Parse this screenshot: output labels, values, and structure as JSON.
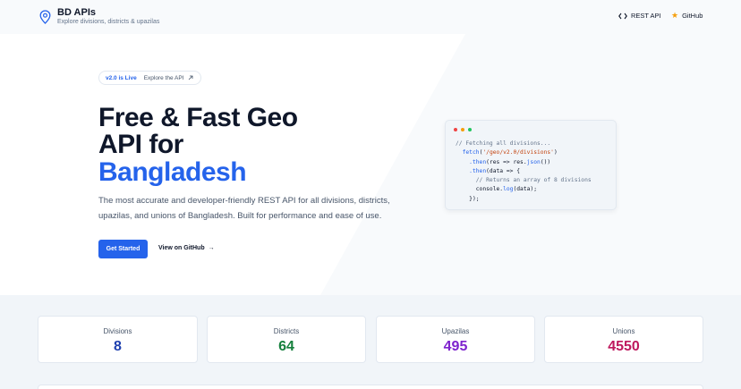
{
  "header": {
    "title": "BD APIs",
    "subtitle": "Explore divisions, districts & upazilas",
    "nav": {
      "rest_api": "REST API",
      "github": "GitHub"
    }
  },
  "hero": {
    "badge": "v2.0 is Live",
    "badge_link": "Explore the API",
    "title_line1": "Free & Fast Geo",
    "title_line2": "API for",
    "title_line3": "Bangladesh",
    "description": "The most accurate and developer-friendly REST API for all divisions, districts, upazilas, and unions of Bangladesh. Built for performance and ease of use.",
    "primary_button": "Get Started",
    "secondary_button": "View on GitHub"
  },
  "code_window": {
    "line1": "// Fetching all divisions...",
    "line2_fn": "fetch",
    "line2_str": "'/geo/v2.0/divisions'",
    "line3_a": ".then",
    "line3_b": "(res => res.",
    "line3_c": "json",
    "line3_d": "())",
    "line4_a": ".then",
    "line4_b": "(data => {",
    "line5": "// Returns an array of 8 divisions",
    "line6_a": "console.",
    "line6_b": "log",
    "line6_c": "(data);",
    "line7": "});"
  },
  "stats": [
    {
      "label": "Divisions",
      "value": "8",
      "color": "#1e40af"
    },
    {
      "label": "Districts",
      "value": "64",
      "color": "#15803d"
    },
    {
      "label": "Upazilas",
      "value": "495",
      "color": "#7e22ce"
    },
    {
      "label": "Unions",
      "value": "4550",
      "color": "#be185d"
    }
  ],
  "colors": {
    "accent": "#2563eb",
    "background": "#f8fafc"
  }
}
